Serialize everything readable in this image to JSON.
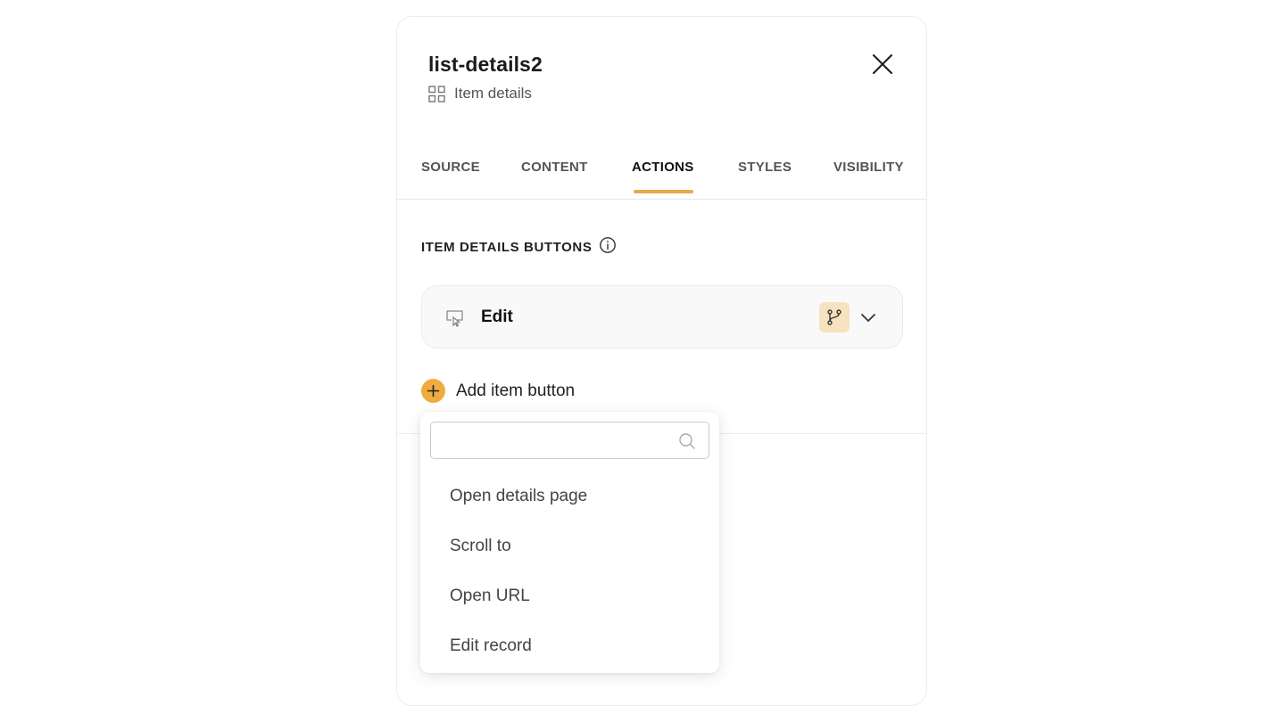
{
  "panel": {
    "title": "list-details2",
    "subtitle": "Item details"
  },
  "tabs": [
    {
      "label": "SOURCE",
      "active": false
    },
    {
      "label": "CONTENT",
      "active": false
    },
    {
      "label": "ACTIONS",
      "active": true
    },
    {
      "label": "STYLES",
      "active": false
    },
    {
      "label": "VISIBILITY",
      "active": false
    }
  ],
  "section": {
    "title": "ITEM DETAILS BUTTONS"
  },
  "buttons": [
    {
      "label": "Edit"
    }
  ],
  "add_button": {
    "label": "Add item button"
  },
  "dropdown": {
    "search_value": "",
    "items": [
      "Open details page",
      "Scroll to",
      "Open URL",
      "Edit record"
    ]
  },
  "colors": {
    "accent": "#e8a84c",
    "add_circle": "#f0ad3f",
    "badge_bg": "#f7e2bf"
  }
}
